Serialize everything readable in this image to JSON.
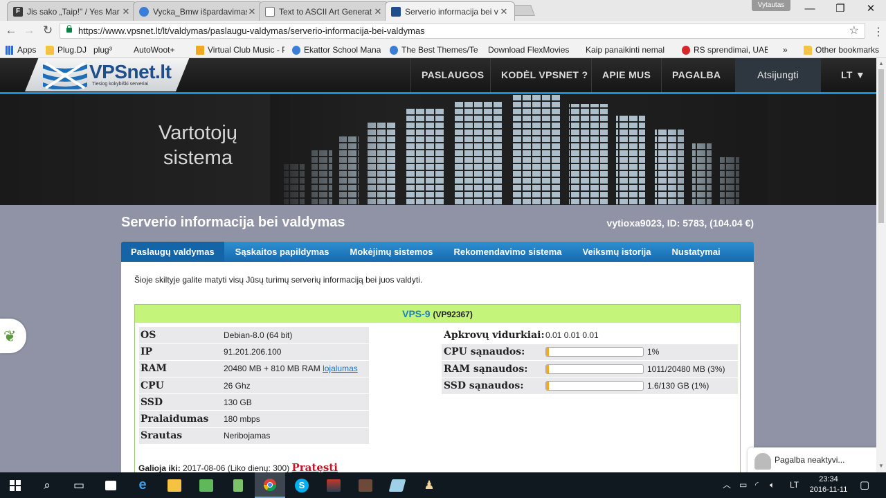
{
  "browser": {
    "tabs": [
      {
        "title": "Jis sako „Taip!\" / Yes Mar",
        "icon": "f-icon",
        "color": "#3b3b3b"
      },
      {
        "title": "Vycka_Bmw išpardavimas",
        "icon": "circle-icon",
        "color": "#3b7ed8"
      },
      {
        "title": "Text to ASCII Art Generat",
        "icon": "page-icon",
        "color": "#ffffff"
      },
      {
        "title": "Serverio informacija bei v",
        "icon": "vpsnet-icon",
        "color": "#1f4e8c"
      }
    ],
    "profile_name": "Vytautas",
    "url": "https://www.vpsnet.lt/lt/valdymas/paslaugu-valdymas/serverio-informacija-bei-valdymas",
    "bookmarks": [
      {
        "label": "Apps",
        "kind": "grid"
      },
      {
        "label": "Plug.DJ",
        "kind": "folder"
      },
      {
        "label": "plug³",
        "kind": "page"
      },
      {
        "label": "AutoWoot+",
        "kind": "page"
      },
      {
        "label": "Virtual Club Music - P",
        "kind": "page"
      },
      {
        "label": "Ekattor School Manag",
        "kind": "page"
      },
      {
        "label": "The Best Themes/Tem",
        "kind": "page"
      },
      {
        "label": "Download FlexMovies",
        "kind": "page"
      },
      {
        "label": "Kaip panaikinti nemal",
        "kind": "page"
      },
      {
        "label": "RS sprendimai, UAB Š",
        "kind": "page"
      }
    ],
    "bookmarks_overflow": "»",
    "other_bookmarks": "Other bookmarks"
  },
  "site": {
    "logo_text": "VPSnet.lt",
    "logo_sub": "Tiesiog kokybiški serveriai",
    "nav": [
      "PASLAUGOS",
      "KODĖL VPSNET ?",
      "APIE MUS",
      "PAGALBA"
    ],
    "logout": "Atsijungti",
    "lang": "LT ▼",
    "hero_title_1": "Vartotojų",
    "hero_title_2": "sistema",
    "page_title": "Serverio informacija bei valdymas",
    "user_info": "vytioxa9023, ID: 5783, (104.04 €)",
    "tabs": [
      "Paslaugų valdymas",
      "Sąskaitos papildymas",
      "Mokėjimų sistemos",
      "Rekomendavimo sistema",
      "Veiksmų istorija",
      "Nustatymai"
    ],
    "intro": "Šioje skiltyje galite matyti visų Jūsų turimų serverių informaciją bei juos valdyti.",
    "vps": {
      "name": "VPS-9",
      "code": "(VP92367)",
      "specs": [
        {
          "k": "OS",
          "v": "Debian-8.0 (64 bit)"
        },
        {
          "k": "IP",
          "v": "91.201.206.100"
        },
        {
          "k": "RAM",
          "v": "20480 MB + 810 MB RAM",
          "link": "lojalumas"
        },
        {
          "k": "CPU",
          "v": "26 Ghz"
        },
        {
          "k": "SSD",
          "v": "130 GB"
        },
        {
          "k": "Pralaidumas",
          "v": "180 mbps"
        },
        {
          "k": "Srautas",
          "v": "Neribojamas"
        }
      ],
      "load_label": "Apkrovų vidurkiai:",
      "load_value": "0.01 0.01 0.01",
      "usage": [
        {
          "k": "CPU sąnaudos:",
          "v": "1%",
          "fraction": 0.01
        },
        {
          "k": "RAM sąnaudos:",
          "v": "1011/20480 MB (3%)",
          "fraction": 0.03
        },
        {
          "k": "SSD sąnaudos:",
          "v": "1.6/130 GB (1%)",
          "fraction": 0.01
        }
      ],
      "valid_label": "Galioja iki:",
      "valid_value": "2017-08-06 (Liko dienų: 300)",
      "renew": "Pratęsti"
    },
    "help_text": "Pagalba neaktyvi..."
  },
  "taskbar": {
    "lang": "LT",
    "time": "23:34",
    "date": "2016-11-11"
  }
}
